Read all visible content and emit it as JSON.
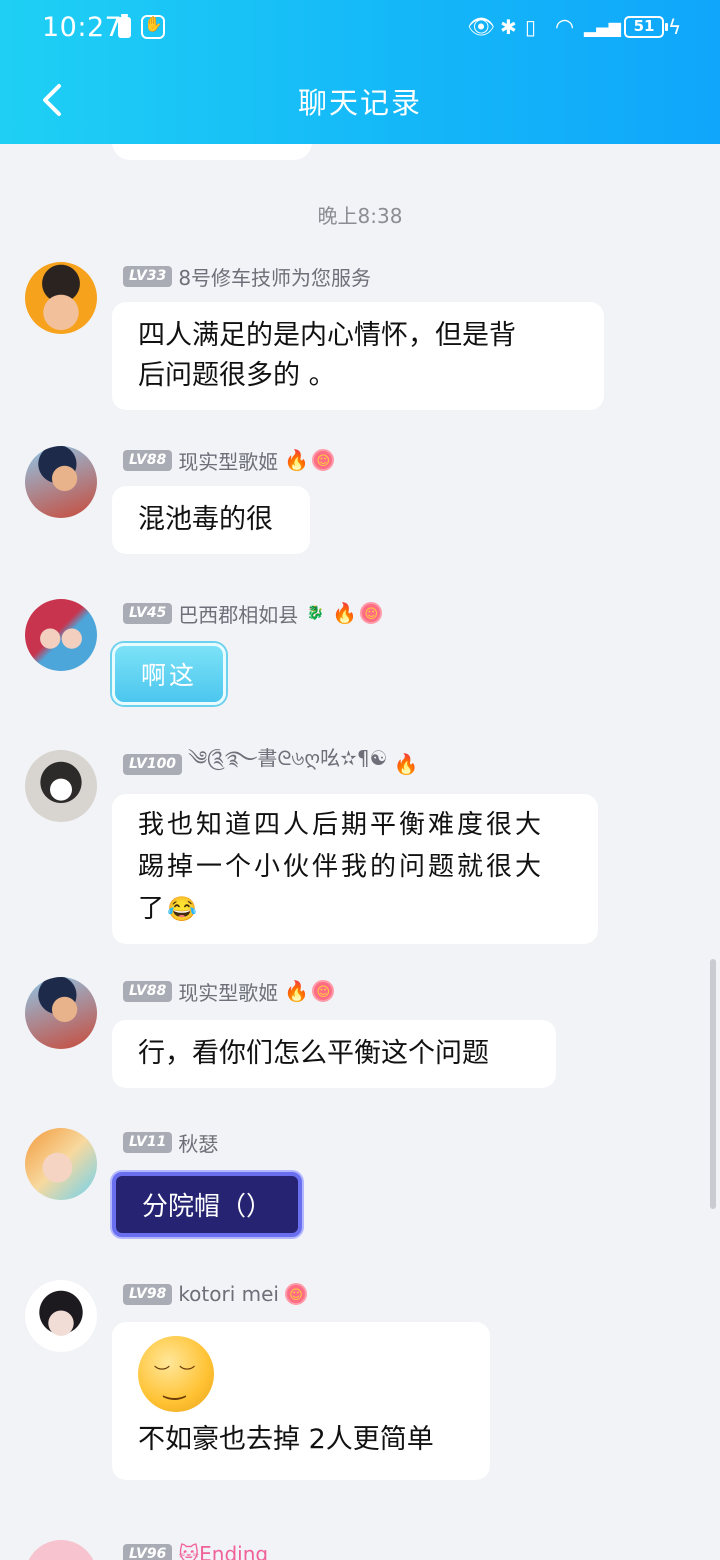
{
  "status_bar": {
    "time": "10:27",
    "battery_level": "51"
  },
  "header": {
    "title": "聊天记录"
  },
  "chat": {
    "timestamp": "晚上8:38",
    "messages": [
      {
        "level": "LV33",
        "name": "8号修车技师为您服务",
        "text_lines": [
          "四人满足的是内心情怀，但是背",
          "后问题很多的 。"
        ]
      },
      {
        "level": "LV88",
        "name": "现实型歌姬",
        "text": "混池毒的很"
      },
      {
        "level": "LV45",
        "name": "巴西郡相如县",
        "text": "啊这"
      },
      {
        "level": "LV100",
        "name": "༄༊࿐書ᘓ৬ღ吆✫¶☯",
        "text_lines": [
          "我也知道四人后期平衡难度很大",
          "踢掉一个小伙伴我的问题就很大",
          "了"
        ]
      },
      {
        "level": "LV88",
        "name": "现实型歌姬",
        "text": "行，看你们怎么平衡这个问题"
      },
      {
        "level": "LV11",
        "name": "秋瑟",
        "text": "分院帽（）"
      },
      {
        "level": "LV98",
        "name": "kotori mei",
        "text": "不如豪也去掉 2人更简单"
      },
      {
        "level": "LV96",
        "name": "Ending"
      }
    ]
  }
}
